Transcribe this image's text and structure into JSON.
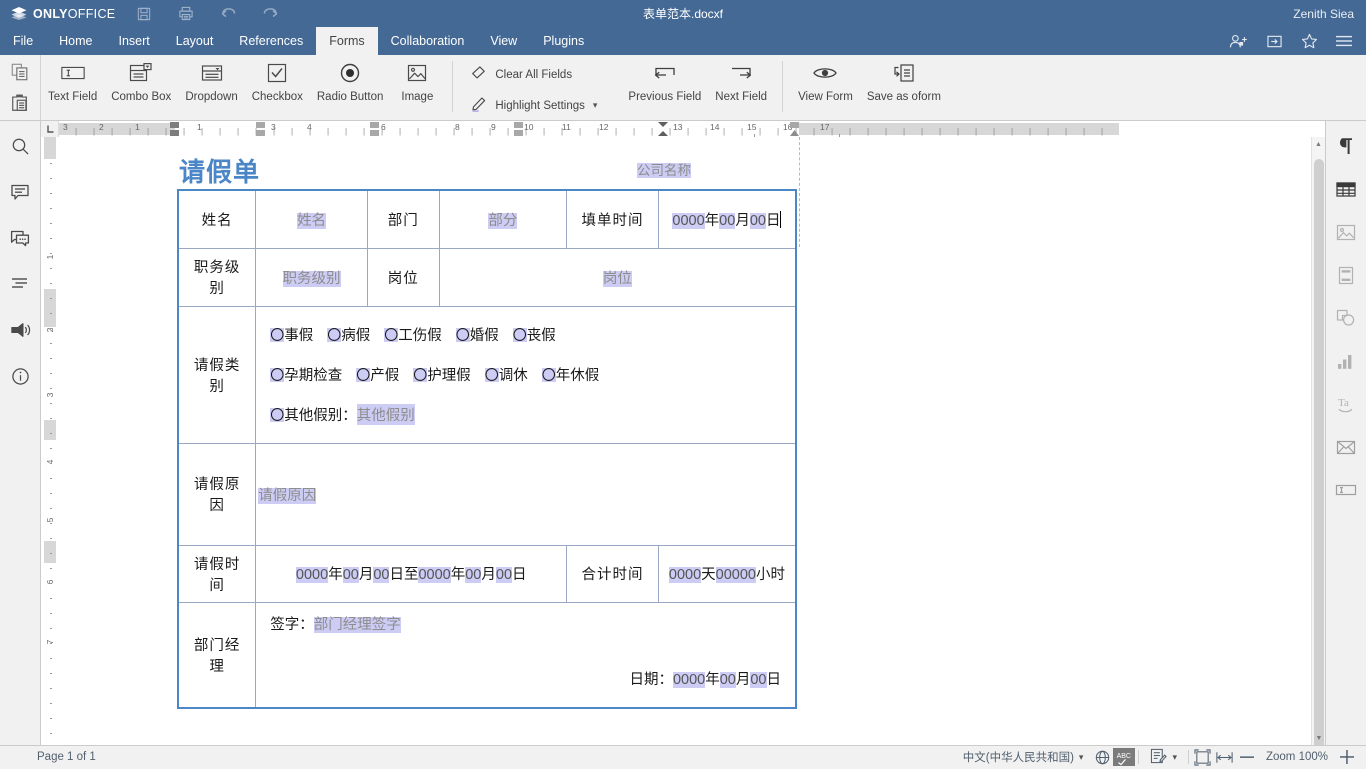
{
  "app": {
    "brand_strong": "ONLY",
    "brand_light": "OFFICE",
    "document_title": "表单范本.docxf",
    "user_name": "Zenith Siea",
    "quick_icons": [
      "save-icon",
      "print-icon",
      "undo-icon",
      "redo-icon"
    ],
    "header_right_icons": [
      "add-user-icon",
      "open-folder-icon",
      "favorite-star-icon",
      "menu-icon"
    ]
  },
  "tabs": [
    {
      "label": "File",
      "active": false
    },
    {
      "label": "Home",
      "active": false
    },
    {
      "label": "Insert",
      "active": false
    },
    {
      "label": "Layout",
      "active": false
    },
    {
      "label": "References",
      "active": false
    },
    {
      "label": "Forms",
      "active": true
    },
    {
      "label": "Collaboration",
      "active": false
    },
    {
      "label": "View",
      "active": false
    },
    {
      "label": "Plugins",
      "active": false
    }
  ],
  "ribbon": {
    "clipboard": [
      "copy-icon",
      "paste-icon"
    ],
    "big_buttons": [
      {
        "label": "Text Field",
        "icon": "text-field-icon"
      },
      {
        "label": "Combo Box",
        "icon": "combo-box-icon"
      },
      {
        "label": "Dropdown",
        "icon": "dropdown-icon"
      },
      {
        "label": "Checkbox",
        "icon": "checkbox-icon"
      },
      {
        "label": "Radio Button",
        "icon": "radio-button-icon"
      },
      {
        "label": "Image",
        "icon": "image-icon"
      }
    ],
    "small_buttons": [
      {
        "label": "Clear All Fields",
        "icon": "eraser-icon",
        "has_caret": false
      },
      {
        "label": "Highlight Settings",
        "icon": "pencil-highlight-icon",
        "has_caret": true
      }
    ],
    "nav_buttons": [
      {
        "label": "Previous Field",
        "icon": "previous-field-icon"
      },
      {
        "label": "Next Field",
        "icon": "next-field-icon"
      }
    ],
    "form_buttons": [
      {
        "label": "View Form",
        "icon": "eye-icon"
      },
      {
        "label": "Save as oform",
        "icon": "save-as-oform-icon"
      }
    ]
  },
  "left_sidebar": [
    {
      "icon": "search-icon",
      "name": "search"
    },
    {
      "icon": "comment-icon",
      "name": "comments"
    },
    {
      "icon": "chat-icon",
      "name": "chat"
    },
    {
      "icon": "headings-icon",
      "name": "navigation"
    },
    {
      "icon": "feedback-megaphone-icon",
      "name": "feedback"
    },
    {
      "icon": "info-icon",
      "name": "about"
    }
  ],
  "right_sidebar": [
    {
      "icon": "paragraph-pilcrow-icon",
      "name": "paragraph-settings",
      "active": true
    },
    {
      "icon": "table-icon",
      "name": "table-settings",
      "active": true
    },
    {
      "icon": "image-settings-icon",
      "name": "image-settings",
      "active": false
    },
    {
      "icon": "header-footer-icon",
      "name": "header-footer-settings",
      "active": false
    },
    {
      "icon": "shape-icon",
      "name": "shape-settings",
      "active": false
    },
    {
      "icon": "chart-icon",
      "name": "chart-settings",
      "active": false
    },
    {
      "icon": "text-art-icon",
      "name": "text-art-settings",
      "active": false
    },
    {
      "icon": "mail-merge-icon",
      "name": "mail-merge-settings",
      "active": false
    },
    {
      "icon": "form-settings-icon",
      "name": "form-settings",
      "active": false
    }
  ],
  "ruler": {
    "h_labels_left": [
      "3",
      "2",
      "1"
    ],
    "h_labels_right": [
      "1",
      "3",
      "4",
      "6",
      "8",
      "9",
      "10",
      "11",
      "12",
      "13",
      "14",
      "15",
      "16",
      "17"
    ],
    "v_labels": [
      "1",
      "2",
      "3",
      "4",
      "5",
      "6",
      "7"
    ]
  },
  "statusbar": {
    "page_count": "Page 1 of 1",
    "language": "中文(中华人民共和国)",
    "zoom_label": "Zoom 100%",
    "icons": [
      "globe-icon",
      "spellcheck-abc-icon",
      "track-changes-icon",
      "fit-page-icon",
      "fit-width-icon",
      "zoom-out-icon",
      "zoom-in-icon"
    ]
  },
  "document": {
    "title": "请假单",
    "company_field": "公司名称",
    "rows": {
      "r1": {
        "name_label": "姓名",
        "name_value": "姓名",
        "dept_label": "部门",
        "dept_value": "部分",
        "date_label": "填单时间",
        "date_year": "0000",
        "date_year_unit": "年",
        "date_month": "00",
        "date_month_unit": "月",
        "date_day": "00",
        "date_day_unit": "日"
      },
      "r2": {
        "rank_label": "职务级别",
        "rank_value": "职务级别",
        "post_label": "岗位",
        "post_value": "岗位"
      },
      "r3": {
        "label": "请假类别",
        "line1": [
          "事假",
          "病假",
          "工伤假",
          "婚假",
          "丧假"
        ],
        "line2": [
          "孕期检查",
          "产假",
          "护理假",
          "调休",
          "年休假"
        ],
        "other_label": "其他假别：",
        "other_value": "其他假别"
      },
      "r4": {
        "label": "请假原因",
        "value": "请假原因"
      },
      "r5": {
        "label": "请假时间",
        "from_year": "0000",
        "from_year_unit": "年",
        "from_month": "00",
        "from_month_unit": "月",
        "from_day": "00",
        "from_day_unit": "日",
        "connector": "至",
        "to_year": "0000",
        "to_year_unit": "年",
        "to_month": "00",
        "to_month_unit": "月",
        "to_day": "00",
        "to_day_unit": "日",
        "total_label": "合计时间",
        "total_days": "0000",
        "total_days_unit": "天",
        "total_hours": "00000",
        "total_hours_unit": "小时"
      },
      "r6": {
        "label": "部门经理",
        "sign_label": "签字：",
        "sign_value": "部门经理签字",
        "date_label": "日期：",
        "date_year": "0000",
        "date_year_unit": "年",
        "date_month": "00",
        "date_month_unit": "月",
        "date_day": "00",
        "date_day_unit": "日"
      }
    }
  },
  "colors": {
    "chrome_blue": "#446995",
    "field_highlight": "#ccccf5",
    "doc_title_blue": "#4b87c7",
    "table_border_outer": "#4b87c7",
    "table_border_inner": "#9aa8c4"
  }
}
